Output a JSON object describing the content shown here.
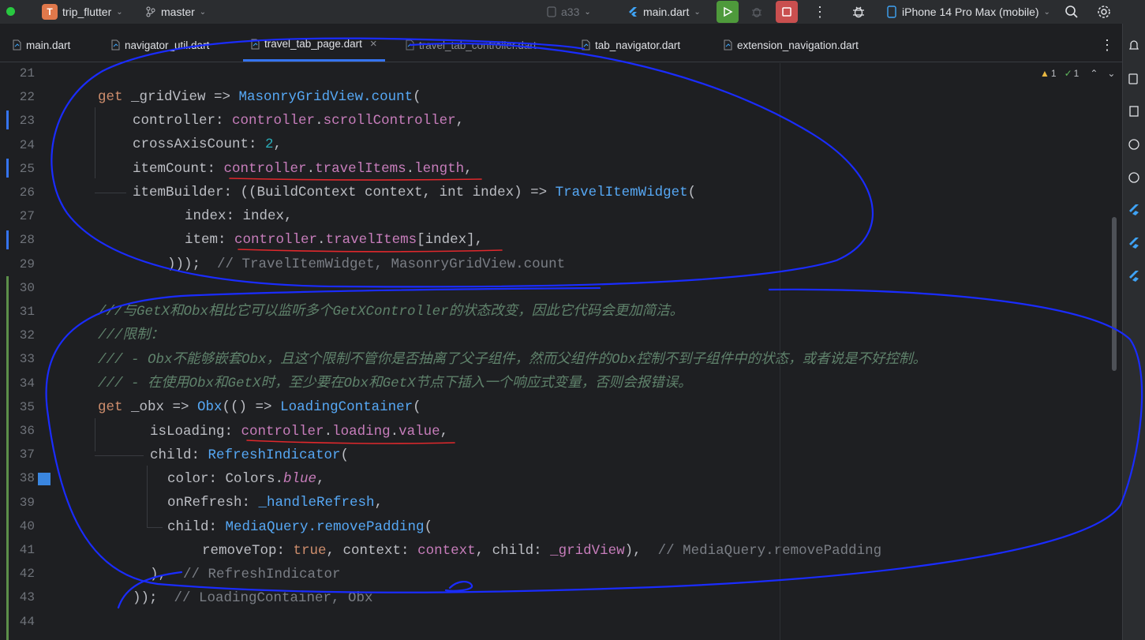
{
  "toolbar": {
    "project_initial": "T",
    "project_name": "trip_flutter",
    "branch": "master",
    "config": "a33",
    "run_config": "main.dart",
    "device": "iPhone 14 Pro Max (mobile)"
  },
  "tabs": [
    {
      "label": "main.dart"
    },
    {
      "label": "navigator_util.dart"
    },
    {
      "label": "travel_tab_page.dart",
      "close": "×"
    },
    {
      "label": "travel_tab_controller.dart"
    },
    {
      "label": "tab_navigator.dart"
    },
    {
      "label": "extension_navigation.dart"
    }
  ],
  "inspections": {
    "warnings": "1",
    "ok": "1"
  },
  "line_numbers": [
    "21",
    "22",
    "23",
    "24",
    "25",
    "26",
    "27",
    "28",
    "29",
    "30",
    "31",
    "32",
    "33",
    "34",
    "35",
    "36",
    "37",
    "38",
    "39",
    "40",
    "41",
    "42",
    "43",
    "44"
  ],
  "code": {
    "l22": {
      "a": "get",
      "b": " _gridView => ",
      "c": "MasonryGridView.count",
      "d": "("
    },
    "l23": {
      "a": "controller: ",
      "b": "controller",
      "c": ".",
      "d": "scrollController",
      "e": ","
    },
    "l24": {
      "a": "crossAxisCount: ",
      "b": "2",
      "c": ","
    },
    "l25": {
      "a": "itemCount: ",
      "b": "controller",
      "c": ".",
      "d": "travelItems",
      "e": ".",
      "f": "length",
      "g": ","
    },
    "l26": {
      "a": "itemBuilder: ((BuildContext context, int index) => ",
      "b": "TravelItemWidget",
      "c": "("
    },
    "l27": {
      "a": "index: index,"
    },
    "l28": {
      "a": "item: ",
      "b": "controller",
      "c": ".",
      "d": "travelItems",
      "e": "[index],"
    },
    "l29": {
      "a": ")));  ",
      "b": "// TravelItemWidget, MasonryGridView.count"
    },
    "l31": {
      "a": "///与",
      "b": "GetX",
      "c": "和",
      "d": "Obx",
      "e": "相比它可以监听多个",
      "f": "GetXController",
      "g": "的状态改变，因此它代码会更加简洁。"
    },
    "l32": {
      "a": "///限制："
    },
    "l33": {
      "a": "/// - ",
      "b": "Obx",
      "c": "不能够嵌套",
      "d": "Obx",
      "e": "，且这个限制不管你是否抽离了父子组件，然而父组件的",
      "f": "Obx",
      "g": "控制不到子组件中的状态，或者说是不好控制。"
    },
    "l34": {
      "a": "/// - 在使用",
      "b": "Obx",
      "c": "和",
      "d": "GetX",
      "e": "时，至少要在",
      "f": "Obx",
      "g": "和",
      "h": "GetX",
      "i": "节点下插入一个响应式变量，否则会报错误。"
    },
    "l35": {
      "a": "get",
      "b": " _obx => ",
      "c": "Obx",
      "d": "(() => ",
      "e": "LoadingContainer",
      "f": "("
    },
    "l36": {
      "a": "isLoading: ",
      "b": "controller",
      "c": ".",
      "d": "loading",
      "e": ".",
      "f": "value",
      "g": ","
    },
    "l37": {
      "a": "child: ",
      "b": "RefreshIndicator",
      "c": "("
    },
    "l38": {
      "a": "color: Colors.",
      "b": "blue",
      "c": ","
    },
    "l39": {
      "a": "onRefresh: ",
      "b": "_handleRefresh",
      "c": ","
    },
    "l40": {
      "a": "child: ",
      "b": "MediaQuery.removePadding",
      "c": "("
    },
    "l41": {
      "a": "removeTop: ",
      "b": "true",
      "c": ", context: ",
      "d": "context",
      "e": ", child: ",
      "f": "_gridView",
      "g": "),  ",
      "h": "// MediaQuery.removePadding"
    },
    "l42": {
      "a": "),  ",
      "b": "// RefreshIndicator"
    },
    "l43": {
      "a": "));  ",
      "b": "// LoadingContainer, Obx"
    }
  },
  "colors": {
    "accent": "#3574f0",
    "annotation_blue": "#1a2cff",
    "annotation_red": "#e0282c"
  }
}
